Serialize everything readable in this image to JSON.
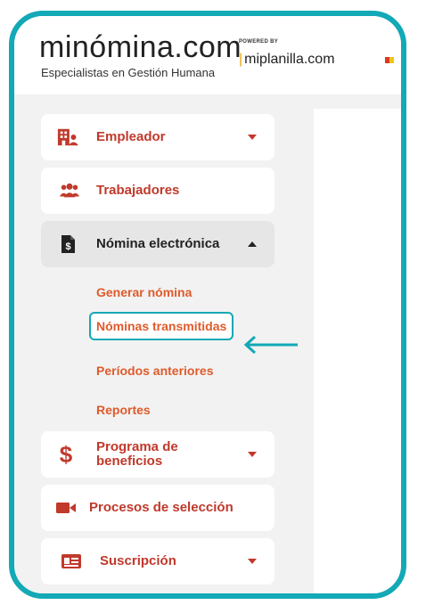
{
  "brand": {
    "logo_text": "minómina.com",
    "tagline": "Especialistas en Gestión Humana",
    "powered_by": "POWERED BY",
    "partner": "miplanilla.com"
  },
  "sidebar": {
    "items": [
      {
        "label": "Empleador",
        "icon": "building-user-icon",
        "caret": "down"
      },
      {
        "label": "Trabajadores",
        "icon": "users-icon"
      },
      {
        "label": "Nómina electrónica",
        "icon": "document-dollar-icon",
        "caret": "up"
      },
      {
        "label": "Programa de beneficios",
        "icon": "dollar-sign-icon",
        "caret": "down"
      },
      {
        "label": "Procesos de selección",
        "icon": "video-camera-icon"
      },
      {
        "label": "Suscripción",
        "icon": "id-card-icon",
        "caret": "down"
      }
    ],
    "submenu": [
      {
        "label": "Generar nómina"
      },
      {
        "label": "Nóminas transmitidas"
      },
      {
        "label": "Períodos anteriores"
      },
      {
        "label": "Reportes"
      }
    ]
  },
  "colors": {
    "frame": "#13a9b6",
    "menu_text": "#c0392b",
    "submenu_text": "#e05a2b",
    "active_bg": "#e6e6e6"
  }
}
